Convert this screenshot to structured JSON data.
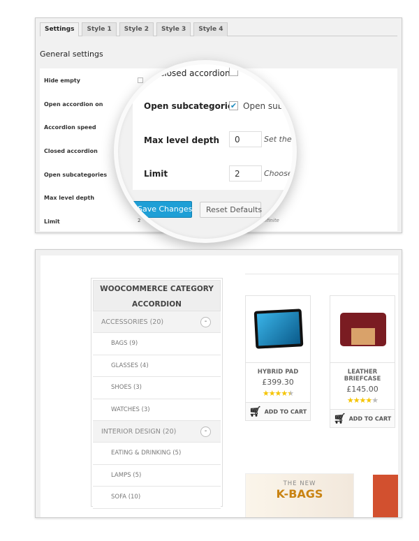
{
  "settings_panel": {
    "tabs": [
      {
        "label": "Settings",
        "active": true
      },
      {
        "label": "Style 1"
      },
      {
        "label": "Style 2"
      },
      {
        "label": "Style 3"
      },
      {
        "label": "Style 4"
      }
    ],
    "section_title": "General settings",
    "fields": [
      "Hide empty",
      "Open accordion on",
      "Accordion speed",
      "Closed accordion",
      "Open subcategories",
      "Max level depth",
      "Limit"
    ],
    "background_limit_value": "2",
    "background_hint": "0 for infinite"
  },
  "magnifier": {
    "closed_accordion_label": "Closed accordion",
    "open_subcategories_label": "Open subcategories",
    "open_subcategories_checked": true,
    "open_subcategories_text": "Open subcategories",
    "max_level_depth_label": "Max level depth",
    "max_level_depth_value": "0",
    "max_level_depth_hint": "Set the depth",
    "limit_label": "Limit",
    "limit_value": "2",
    "limit_hint": "Choose how",
    "save_label": "Save Changes",
    "reset_label": "Reset Defaults",
    "accent": "#1e9fd6"
  },
  "widget": {
    "title": "WOOCOMMERCE CATEGORY ACCORDION",
    "categories": [
      {
        "label": "ACCESSORIES (20)",
        "toggle": "-",
        "children": [
          "BAGS (9)",
          "GLASSES (4)",
          "SHOES (3)",
          "WATCHES (3)"
        ]
      },
      {
        "label": "INTERIOR DESIGN (20)",
        "toggle": "-",
        "children": [
          "EATING & DRINKING (5)",
          "LAMPS (5)",
          "SOFA (10)"
        ]
      }
    ]
  },
  "products": [
    {
      "name": "HYBRID PAD",
      "price": "£399.30",
      "rating": 4.5,
      "stars": "★★★★",
      "half": "★",
      "cart": "ADD TO CART"
    },
    {
      "name": "LEATHER BRIEFCASE",
      "price": "£145.00",
      "rating": 4,
      "stars": "★★★★",
      "off": "★",
      "cart": "ADD TO CART"
    }
  ],
  "banner": {
    "small": "THE NEW",
    "big": "K-BAGS"
  }
}
